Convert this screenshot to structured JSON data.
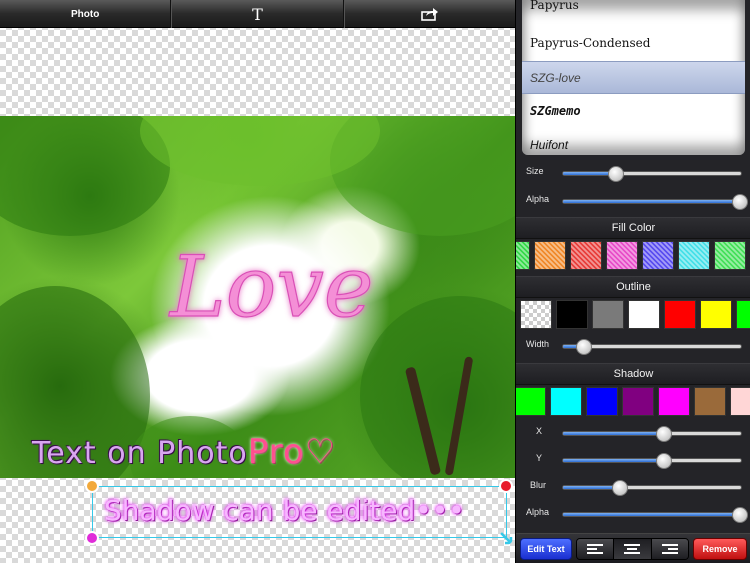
{
  "toolbar": {
    "photo_label": "Photo",
    "text_label": "T",
    "share_icon": "share-arrow-icon"
  },
  "canvas": {
    "love_text": "Love",
    "caption_main": "Text on Photo",
    "caption_pro": "Pro",
    "caption_pro_suffix": "♡",
    "selected_caption": "Shadow can be edited•••"
  },
  "font_picker": {
    "items": [
      "Papyrus",
      "Papyrus-Condensed",
      "SZG-love",
      "SZGmemo",
      "Huifont"
    ],
    "selected": "SZG-love"
  },
  "sliders": {
    "size": {
      "label": "Size",
      "value": 0.3
    },
    "alpha": {
      "label": "Alpha",
      "value": 1.0
    },
    "outline_width": {
      "label": "Width",
      "value": 0.12
    },
    "shadow_x": {
      "label": "X",
      "value": 0.57
    },
    "shadow_y": {
      "label": "Y",
      "value": 0.57
    },
    "shadow_blur": {
      "label": "Blur",
      "value": 0.32
    },
    "shadow_alpha": {
      "label": "Alpha",
      "value": 1.0
    }
  },
  "sections": {
    "fill_color": "Fill Color",
    "outline": "Outline",
    "shadow": "Shadow"
  },
  "colors": {
    "fill": [
      "#36d94a",
      "#f08a2c",
      "#e8403c",
      "#e84ec9",
      "#5a4ef0",
      "#47e0e8",
      "#46e05a"
    ],
    "outline": [
      "#ffffff",
      "#000000",
      "#7a7a7a",
      "#ffffff",
      "#ff0000",
      "#ffff00",
      "#00ff00"
    ],
    "shadow": [
      "#00ff00",
      "#00ffff",
      "#0000ff",
      "#800080",
      "#ff00ff",
      "#9a6a3a",
      "#ffd6d6"
    ]
  },
  "bottom_bar": {
    "edit_text": "Edit Text",
    "remove": "Remove",
    "align_options": [
      "align-left-icon",
      "align-center-icon",
      "align-right-icon"
    ]
  }
}
